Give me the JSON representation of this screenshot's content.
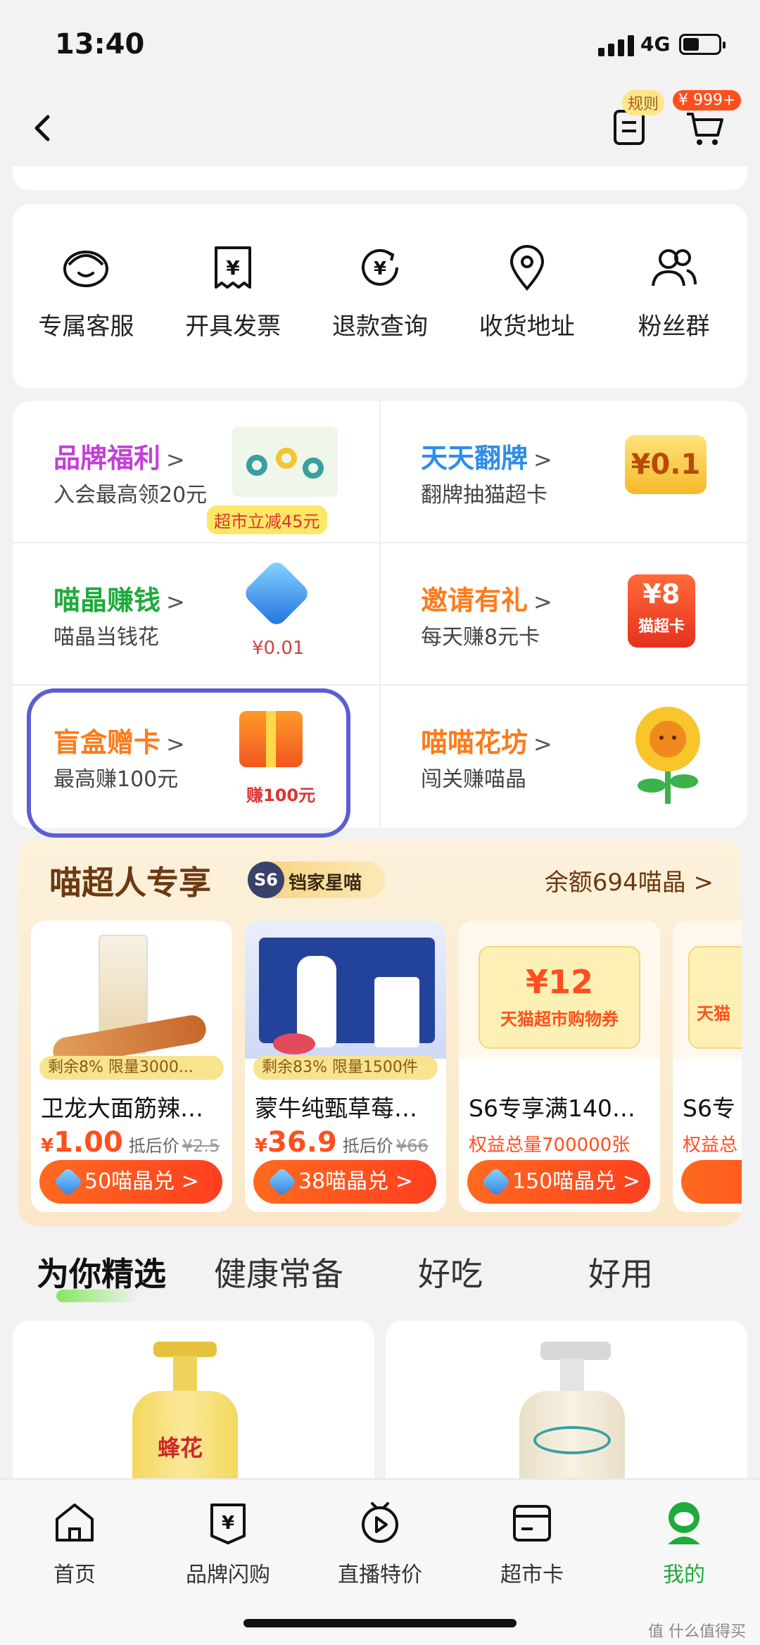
{
  "status": {
    "time": "13:40",
    "network": "4G"
  },
  "nav": {
    "rules_badge": "规则",
    "cart_badge": "¥ 999+"
  },
  "services": [
    {
      "label": "专属客服",
      "icon": "customer-service-icon"
    },
    {
      "label": "开具发票",
      "icon": "invoice-icon"
    },
    {
      "label": "退款查询",
      "icon": "refund-icon"
    },
    {
      "label": "收货地址",
      "icon": "location-icon"
    },
    {
      "label": "粉丝群",
      "icon": "fans-group-icon"
    }
  ],
  "features": [
    {
      "title": "品牌福利",
      "sub": "入会最高领20元",
      "color": "#c43fd6",
      "badge": "超市立减45元"
    },
    {
      "title": "天天翻牌",
      "sub": "翻牌抽猫超卡",
      "color": "#2f8de8",
      "badge": "¥0.1"
    },
    {
      "title": "喵晶赚钱",
      "sub": "喵晶当钱花",
      "color": "#1faa3c",
      "badge": "¥0.01"
    },
    {
      "title": "邀请有礼",
      "sub": "每天赚8元卡",
      "color": "#ff7a1a",
      "badge": "¥8",
      "badge2": "猫超卡"
    },
    {
      "title": "盲盒赠卡",
      "sub": "最高赚100元",
      "color": "#ff7a1a",
      "badge": "赚100元"
    },
    {
      "title": "喵喵花坊",
      "sub": "闯关赚喵晶",
      "color": "#ff7a1a"
    }
  ],
  "super": {
    "title": "喵超人专享",
    "s6_logo": "S6",
    "s6_text": "铛家星喵",
    "balance": "余额694喵晶 >",
    "cards": [
      {
        "tag": "剩余8% 限量3000...",
        "name": "卫龙大面筋辣…",
        "price_currency": "¥",
        "price": "1.00",
        "after_label": "抵后价",
        "old_price": "¥2.5",
        "button": "50喵晶兑 >"
      },
      {
        "tag": "剩余83% 限量1500件",
        "name": "蒙牛纯甄草莓…",
        "price_currency": "¥",
        "price": "36.9",
        "after_label": "抵后价",
        "old_price": "¥66",
        "button": "38喵晶兑 >"
      },
      {
        "voucher_amount": "¥12",
        "voucher_label": "天猫超市购物券",
        "name": "S6专享满140…",
        "sub": "权益总量700000张",
        "button": "150喵晶兑 >"
      },
      {
        "voucher_label": "天猫",
        "name": "S6专",
        "sub": "权益总"
      }
    ]
  },
  "tabs": [
    "为你精选",
    "健康常备",
    "好吃",
    "好用"
  ],
  "products": [
    {
      "brand": "蜂花"
    }
  ],
  "bottom_nav": [
    {
      "label": "首页",
      "icon": "home-icon"
    },
    {
      "label": "品牌闪购",
      "icon": "flash-sale-icon"
    },
    {
      "label": "直播特价",
      "icon": "live-icon"
    },
    {
      "label": "超市卡",
      "icon": "market-card-icon"
    },
    {
      "label": "我的",
      "icon": "profile-icon",
      "active": true
    }
  ],
  "watermark": "值 什么值得买"
}
